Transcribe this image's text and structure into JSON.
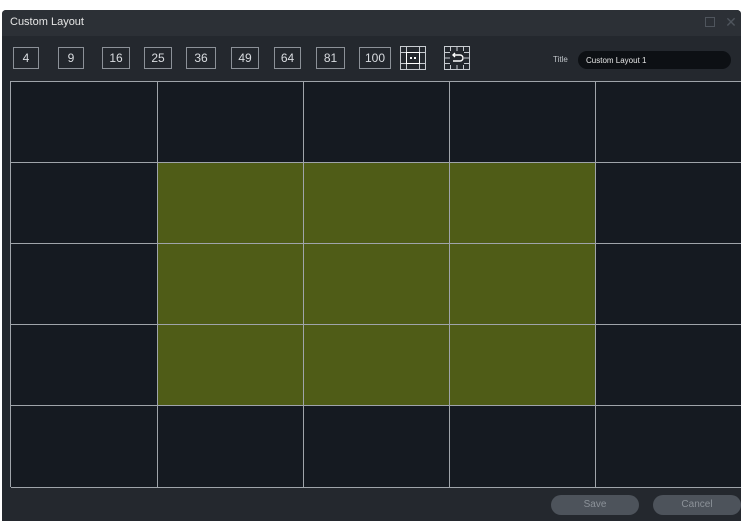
{
  "window": {
    "title": "Custom Layout",
    "maximize_icon": "maximize-icon",
    "close_icon": "close-icon",
    "close_glyph": "✕"
  },
  "toolbar": {
    "presets": [
      "4",
      "9",
      "16",
      "25",
      "36",
      "49",
      "64",
      "81",
      "100"
    ],
    "merge_icon": "merge-cells-icon",
    "split_icon": "undo-split-icon",
    "title_label": "Title",
    "title_value": "Custom Layout 1"
  },
  "grid": {
    "rows": 5,
    "cols": 5,
    "selected_block": {
      "row_start": 1,
      "row_end": 3,
      "col_start": 1,
      "col_end": 3
    },
    "cell_color": "#151a21",
    "selected_color": "#4f5c17",
    "line_color": "#9fa4aa"
  },
  "footer": {
    "save_label": "Save",
    "cancel_label": "Cancel"
  }
}
